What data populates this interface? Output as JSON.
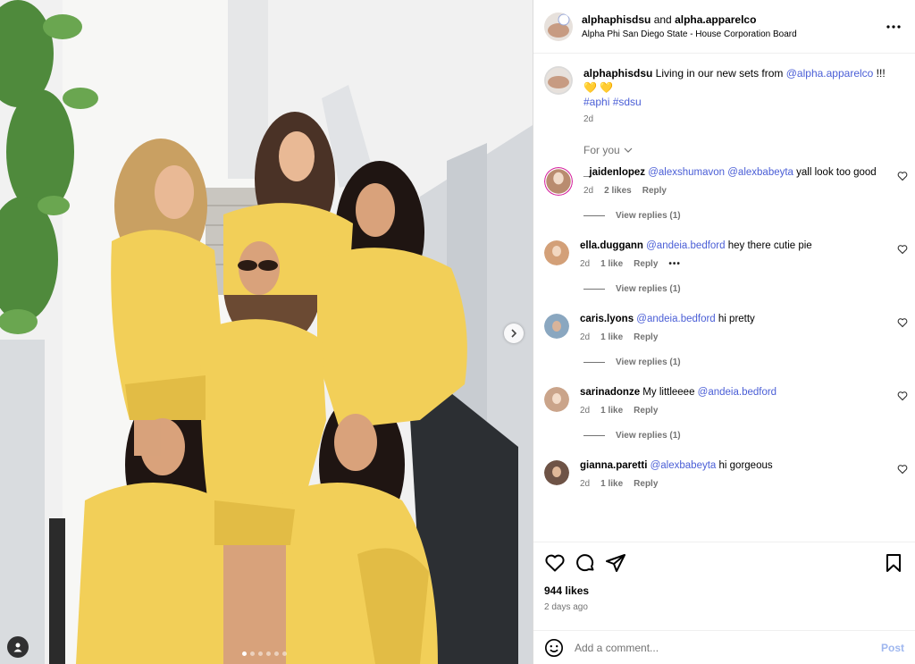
{
  "post": {
    "author": "alphaphisdsu",
    "and": "and",
    "collaborator": "alpha.apparelco",
    "location": "Alpha Phi San Diego State - House Corporation Board"
  },
  "caption": {
    "username": "alphaphisdsu",
    "text": " Living in our new sets from ",
    "mention": "@alpha.apparelco",
    "text_end": " !!!",
    "emoji": "💛 💛",
    "hashtags": "#aphi #sdsu",
    "time": "2d"
  },
  "for_you_label": "For you",
  "reply_label": "Reply",
  "comments": [
    {
      "username": "_jaidenlopez",
      "mentions": "@alexshumavon @alexbabeyta",
      "text": " yall look too good",
      "time": "2d",
      "likes": "2 likes",
      "view_replies": "View replies (1)",
      "avatar_color": "#b98c6f"
    },
    {
      "username": "ella.duggann",
      "mentions": "@andeia.bedford",
      "text": " hey there cutie pie",
      "time": "2d",
      "likes": "1 like",
      "more": "•••",
      "view_replies": "View replies (1)",
      "avatar_color": "#d3a078"
    },
    {
      "username": "caris.lyons",
      "mentions": "@andeia.bedford",
      "text": " hi pretty",
      "time": "2d",
      "likes": "1 like",
      "view_replies": "View replies (1)",
      "avatar_color": "#8aa7c0"
    },
    {
      "username": "sarinadonze",
      "pre_text": " My littleeee ",
      "mentions": "@andeia.bedford",
      "text": "",
      "time": "2d",
      "likes": "1 like",
      "view_replies": "View replies (1)",
      "avatar_color": "#caa48a"
    },
    {
      "username": "gianna.paretti",
      "mentions": "@alexbabeyta",
      "text": " hi gorgeous",
      "time": "2d",
      "likes": "1 like",
      "avatar_color": "#6e5346"
    }
  ],
  "stats": {
    "likes": "944 likes",
    "time_ago": "2 days ago"
  },
  "composer": {
    "placeholder": "Add a comment...",
    "post_label": "Post"
  },
  "colors": {
    "link": "#4a5ed6",
    "muted": "#737373",
    "post_disabled": "#9fb7ef",
    "hoodie": "#f2cf58"
  },
  "carousel": {
    "slide_count": 6,
    "active_index": 0
  },
  "icons": [
    "more-icon",
    "heart-icon",
    "comment-icon",
    "share-icon",
    "bookmark-icon",
    "emoji-icon",
    "chevron-right-icon",
    "user-tag-icon"
  ]
}
